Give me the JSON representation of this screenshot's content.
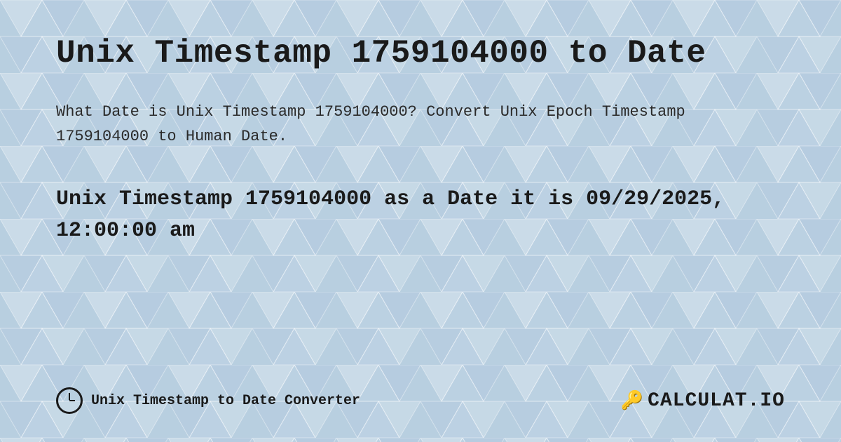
{
  "background": {
    "color": "#c8d8ed"
  },
  "header": {
    "title": "Unix Timestamp 1759104000 to Date"
  },
  "description": {
    "text": "What Date is Unix Timestamp 1759104000? Convert Unix Epoch Timestamp 1759104000 to Human Date."
  },
  "result": {
    "text": "Unix Timestamp 1759104000 as a Date it is 09/29/2025, 12:00:00 am"
  },
  "footer": {
    "label": "Unix Timestamp to Date Converter",
    "logo_text": "CALCULAT.IO"
  }
}
